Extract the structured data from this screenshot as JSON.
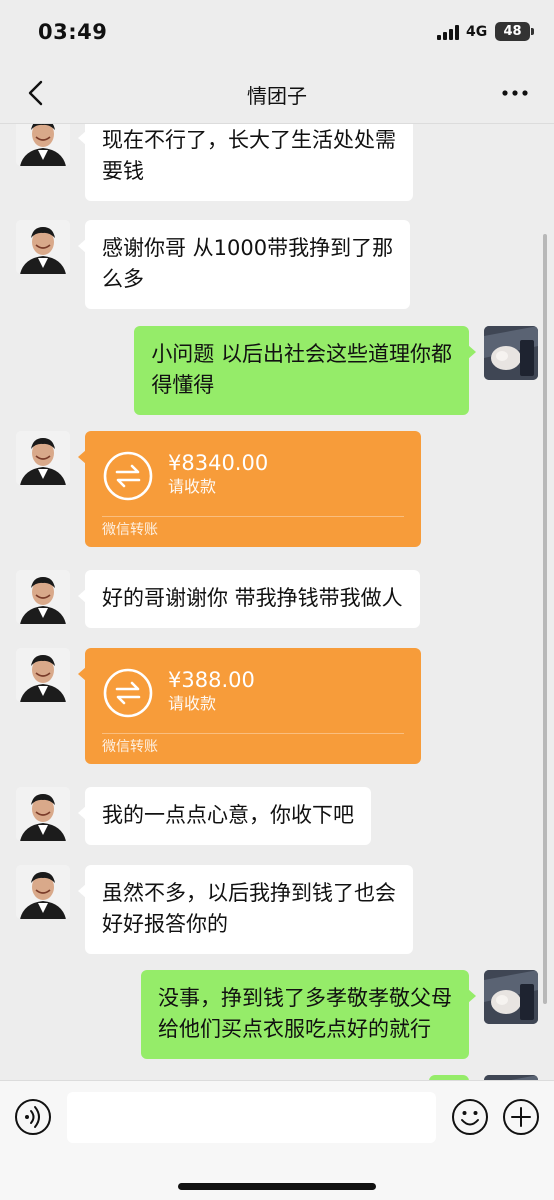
{
  "status_bar": {
    "time": "03:49",
    "network": "4G",
    "battery": "48"
  },
  "nav": {
    "title": "情团子"
  },
  "messages": [
    {
      "side": "left",
      "type": "text",
      "text": "现在不行了，长大了生活处处需\n要钱"
    },
    {
      "side": "left",
      "type": "text",
      "text": "感谢你哥 从1000带我挣到了那\n么多"
    },
    {
      "side": "right",
      "type": "text",
      "text": "小问题 以后出社会这些道理你都\n得懂得"
    },
    {
      "side": "left",
      "type": "transfer",
      "amount": "¥8340.00",
      "status": "请收款",
      "source": "微信转账"
    },
    {
      "side": "left",
      "type": "text",
      "text": "好的哥谢谢你 带我挣钱带我做人"
    },
    {
      "side": "left",
      "type": "transfer",
      "amount": "¥388.00",
      "status": "请收款",
      "source": "微信转账"
    },
    {
      "side": "left",
      "type": "text",
      "text": "我的一点点心意，你收下吧"
    },
    {
      "side": "left",
      "type": "text",
      "text": "虽然不多，以后我挣到钱了也会\n好好报答你的"
    },
    {
      "side": "right",
      "type": "text",
      "text": "没事，挣到钱了多孝敬孝敬父母\n给他们买点衣服吃点好的就行"
    }
  ],
  "input": {
    "value": "",
    "placeholder": ""
  },
  "colors": {
    "background": "#ededed",
    "own_bubble": "#95ec69",
    "other_bubble": "#ffffff",
    "transfer_card": "#f79c3a"
  },
  "icons": {
    "back": "chevron-left-icon",
    "more": "more-dots-icon",
    "voice": "voice-icon",
    "emoji": "emoji-icon",
    "plus": "plus-icon",
    "transfer": "transfer-arrows-icon"
  }
}
